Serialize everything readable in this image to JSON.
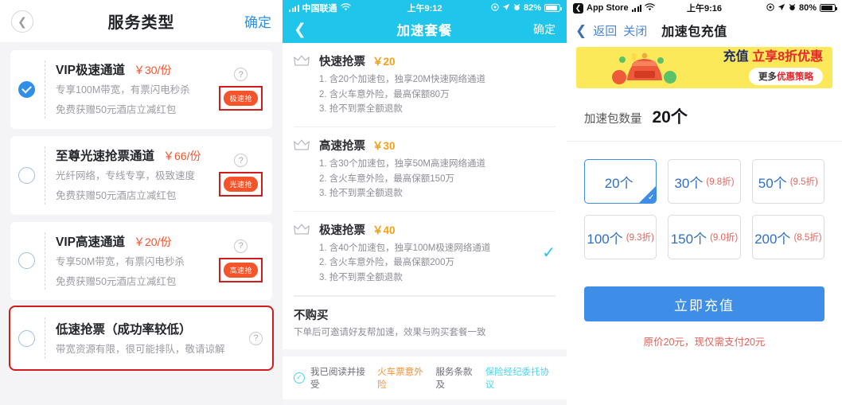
{
  "panel1": {
    "back_icon": "chevron-left-icon",
    "title": "服务类型",
    "confirm_label": "确定",
    "help_glyph": "?",
    "cards": [
      {
        "name": "VIP极速通道",
        "price": "￥30/份",
        "desc_line1": "专享100M带宽，有票闪电秒杀",
        "desc_line2": "免费获赠50元酒店立减红包",
        "tag": "极速抢",
        "selected": true,
        "tag_highlighted": true,
        "card_highlighted": false
      },
      {
        "name": "至尊光速抢票通道",
        "price": "￥66/份",
        "desc_line1": "光纤网络，专线专享，极致速度",
        "desc_line2": "免费获赠50元酒店立减红包",
        "tag": "光速抢",
        "selected": false,
        "tag_highlighted": true,
        "card_highlighted": false
      },
      {
        "name": "VIP高速通道",
        "price": "￥20/份",
        "desc_line1": "专享50M带宽，有票闪电秒杀",
        "desc_line2": "免费获赠50元酒店立减红包",
        "tag": "高速抢",
        "selected": false,
        "tag_highlighted": true,
        "card_highlighted": false
      },
      {
        "name": "低速抢票（成功率较低）",
        "price": "",
        "desc_line1": "带宽资源有限，很可能排队，敬请谅解",
        "desc_line2": "",
        "tag": "",
        "selected": false,
        "tag_highlighted": false,
        "card_highlighted": true
      }
    ]
  },
  "panel2": {
    "status": {
      "carrier": "中国联通",
      "time": "上午9:12",
      "battery": "82%",
      "wifi_icon": "wifi-icon",
      "signal_icon": "signal-bars-icon",
      "location_icon": "location-arrow-icon",
      "alarm_icon": "alarm-clock-icon",
      "rotation_icon": "rotation-lock-icon",
      "battery_icon": "battery-icon"
    },
    "back_icon": "chevron-left-icon",
    "title": "加速套餐",
    "confirm_label": "确定",
    "packages": [
      {
        "icon": "crown-icon",
        "name": "快速抢票",
        "price": "￥20",
        "lines": [
          "1. 含20个加速包，独享20M快速网络通道",
          "2. 含火车意外险，最高保额80万",
          "3. 抢不到票全额退款"
        ],
        "selected": false
      },
      {
        "icon": "crown-icon",
        "name": "高速抢票",
        "price": "￥30",
        "lines": [
          "1. 含30个加速包，独享50M高速网络通道",
          "2. 含火车意外险，最高保额150万",
          "3. 抢不到票全额退款"
        ],
        "selected": false
      },
      {
        "icon": "crown-icon",
        "name": "极速抢票",
        "price": "￥40",
        "lines": [
          "1. 含40个加速包，独享100M极速网络通道",
          "2. 含火车意外险，最高保额200万",
          "3. 抢不到票全额退款"
        ],
        "selected": true
      }
    ],
    "nobuy": {
      "title": "不购买",
      "desc": "下单后可邀请好友帮加速，效果与购买套餐一致"
    },
    "agreement": {
      "check_icon": "check-circle-icon",
      "prefix": "我已阅读并接受",
      "link1": "火车票意外险",
      "middle": "服务条款及",
      "link2": "保险经纪委托协议"
    }
  },
  "panel3": {
    "status": {
      "app_label": "App Store",
      "app_back_icon": "back-app-icon",
      "time": "上午9:16",
      "battery": "80%",
      "signal_icon": "signal-bars-icon",
      "wifi_icon": "wifi-icon",
      "location_icon": "location-arrow-icon",
      "alarm_icon": "alarm-clock-icon",
      "rotation_icon": "rotation-lock-icon",
      "battery_icon": "battery-icon"
    },
    "nav": {
      "chev_icon": "chevron-left-icon",
      "back_label": "返回",
      "close_label": "关闭",
      "title": "加速包充值"
    },
    "banner": {
      "image_icon": "money-sack-icon",
      "headline_a": "充值",
      "headline_b": "立享8折优惠",
      "pill_a": "更多",
      "pill_b": "优惠策略"
    },
    "qty": {
      "label": "加速包数量",
      "value": "20个"
    },
    "options": [
      {
        "count": "20个",
        "discount": "",
        "selected": true
      },
      {
        "count": "30个",
        "discount": "(9.8折)",
        "selected": false
      },
      {
        "count": "50个",
        "discount": "(9.5折)",
        "selected": false
      },
      {
        "count": "100个",
        "discount": "(9.3折)",
        "selected": false
      },
      {
        "count": "150个",
        "discount": "(9.0折)",
        "selected": false
      },
      {
        "count": "200个",
        "discount": "(8.5折)",
        "selected": false
      }
    ],
    "pay_button": "立即充值",
    "pay_note": "原价20元，现仅需支付20元"
  },
  "colors": {
    "accent_blue": "#3e8ee8",
    "cyan_header": "#1fc5ea",
    "tag_orange": "#f5542b",
    "highlight_red": "#d21b1b",
    "price_orange": "#f2542d",
    "banner_yellow": "#fbe959"
  }
}
